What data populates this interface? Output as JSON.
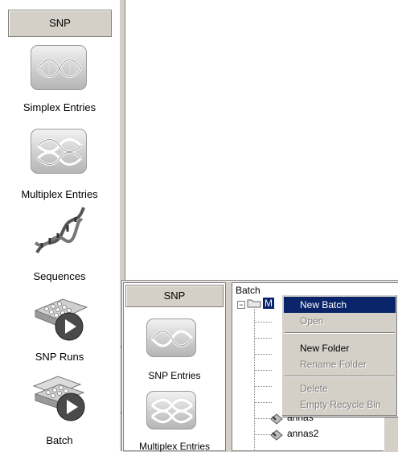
{
  "left_panel": {
    "header": "SNP",
    "items": [
      {
        "label": "Simplex Entries",
        "icon": "dna-simplex-icon"
      },
      {
        "label": "Multiplex Entries",
        "icon": "dna-multiplex-icon"
      },
      {
        "label": "Sequences",
        "icon": "dna-helix-icon"
      },
      {
        "label": "SNP Runs",
        "icon": "plate-run-icon"
      },
      {
        "label": "Batch",
        "icon": "plate-batch-icon"
      }
    ]
  },
  "overlay_panel": {
    "header": "SNP",
    "items": [
      {
        "label": "SNP Entries",
        "icon": "dna-simplex-icon"
      },
      {
        "label": "Multiplex Entries",
        "icon": "dna-multiplex-icon"
      }
    ]
  },
  "batch_panel": {
    "title": "Batch",
    "tree": {
      "root_label": "M",
      "items": [
        "annas",
        "annas2"
      ]
    }
  },
  "context_menu": {
    "items": [
      {
        "label": "New Batch",
        "state": "highlighted"
      },
      {
        "label": "Open",
        "state": "disabled"
      },
      {
        "label": "New Folder",
        "state": "enabled"
      },
      {
        "label": "Rename Folder",
        "state": "disabled"
      },
      {
        "label": "Delete",
        "state": "disabled"
      },
      {
        "label": "Empty Recycle Bin",
        "state": "disabled"
      }
    ]
  },
  "colors": {
    "face": "#d4d0c8",
    "highlight": "#0a246a",
    "disabled_text": "#808080"
  }
}
